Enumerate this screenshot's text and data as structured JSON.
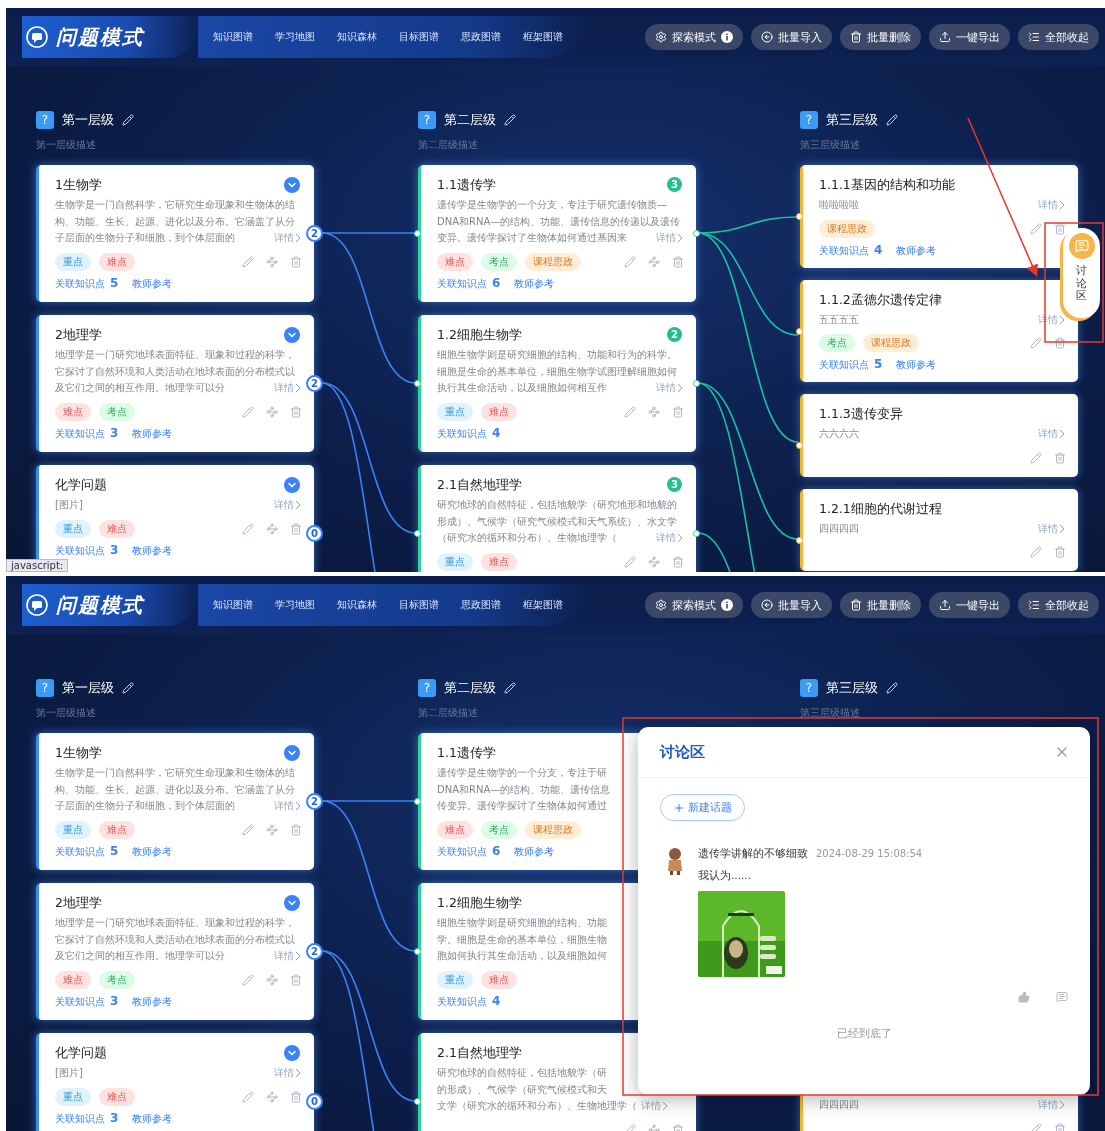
{
  "screens": [
    {
      "header": {
        "title": "问题模式",
        "nav": [
          "知识图谱",
          "学习地图",
          "知识森林",
          "目标图谱",
          "思政图谱",
          "框架图谱"
        ],
        "actions": [
          {
            "label": "探索模式",
            "kind": "explore"
          },
          {
            "label": "批量导入",
            "kind": "import"
          },
          {
            "label": "批量删除",
            "kind": "delete"
          },
          {
            "label": "一键导出",
            "kind": "export"
          },
          {
            "label": "全部收起",
            "kind": "collapse"
          }
        ]
      },
      "columns": [
        {
          "kind": "first",
          "mark": "?",
          "title": "第一层级",
          "description": "第一层级描述",
          "cards": [
            {
              "title": "1生物学",
              "description": "生物学是一门自然科学，它研究生命现象和生物体的结构、功能、生长、起源、进化以及分布。它涵盖了从分子层面的生物分子和细胞，到个体层面的",
              "detail": "详情",
              "tags": [
                {
                  "label": "重点",
                  "kind": "key"
                },
                {
                  "label": "难点",
                  "kind": "hard"
                }
              ],
              "related_label": "关联知识点",
              "related_count": "5",
              "reference": "教师参考",
              "links": "2",
              "tools": true
            },
            {
              "title": "2地理学",
              "description": "地理学是一门研究地球表面特征、现象和过程的科学，它探讨了自然环境和人类活动在地球表面的分布模式以及它们之间的相互作用。地理学可以分",
              "detail": "详情",
              "tags": [
                {
                  "label": "难点",
                  "kind": "hard"
                },
                {
                  "label": "考点",
                  "kind": "exam"
                }
              ],
              "related_label": "关联知识点",
              "related_count": "3",
              "reference": "教师参考",
              "links": "2",
              "tools": true
            },
            {
              "title": "化学问题",
              "description": "[图片]",
              "detail": "详情",
              "tags": [
                {
                  "label": "重点",
                  "kind": "key"
                },
                {
                  "label": "难点",
                  "kind": "hard"
                }
              ],
              "related_label": "关联知识点",
              "related_count": "3",
              "reference": "教师参考",
              "links": "0",
              "tools": true
            }
          ]
        },
        {
          "kind": "second",
          "mark": "?",
          "title": "第二层级",
          "description": "第二层级描述",
          "cards": [
            {
              "title": "1.1遗传学",
              "description": "遗传学是生物学的一个分支，专注于研究遗传物质—DNA和RNA—的结构、功能、遗传信息的传递以及遗传变异。遗传学探讨了生物体如何通过基因来",
              "detail": "详情",
              "tags": [
                {
                  "label": "难点",
                  "kind": "hard"
                },
                {
                  "label": "考点",
                  "kind": "exam"
                },
                {
                  "label": "课程思政",
                  "kind": "ideology"
                }
              ],
              "related_label": "关联知识点",
              "related_count": "6",
              "reference": "教师参考",
              "count": "3",
              "tools": true
            },
            {
              "title": "1.2细胞生物学",
              "description": "细胞生物学则是研究细胞的结构、功能和行为的科学。细胞是生命的基本单位，细胞生物学试图理解细胞如何执行其生命活动，以及细胞如何相互作",
              "detail": "详情",
              "tags": [
                {
                  "label": "重点",
                  "kind": "key"
                },
                {
                  "label": "难点",
                  "kind": "hard"
                }
              ],
              "related_label": "关联知识点",
              "related_count": "4",
              "count": "2",
              "tools": true
            },
            {
              "title": "2.1自然地理学",
              "description": "研究地球的自然特征，包括地貌学（研究地形和地貌的形成）、气候学（研究气候模式和天气系统）、水文学（研究水的循环和分布）、生物地理学（",
              "detail": "详情",
              "tags": [
                {
                  "label": "重点",
                  "kind": "key"
                },
                {
                  "label": "难点",
                  "kind": "hard"
                }
              ],
              "count": "3",
              "tools": true
            }
          ]
        },
        {
          "kind": "third",
          "mark": "?",
          "title": "第三层级",
          "description": "第三层级描述",
          "cards": [
            {
              "title": "1.1.1基因的结构和功能",
              "description": "啦啦啦啦",
              "detail": "详情",
              "tags": [
                {
                  "label": "课程思政",
                  "kind": "ideology"
                }
              ],
              "related_label": "关联知识点",
              "related_count": "4",
              "reference": "教师参考",
              "tools": true
            },
            {
              "title": "1.1.2孟德尔遗传定律",
              "description": "五五五五",
              "detail": "详情",
              "tags": [
                {
                  "label": "考点",
                  "kind": "exam"
                },
                {
                  "label": "课程思政",
                  "kind": "ideology"
                }
              ],
              "related_label": "关联知识点",
              "related_count": "5",
              "reference": "教师参考",
              "tools": true
            },
            {
              "title": "1.1.3遗传变异",
              "description": "六六六六",
              "detail": "详情",
              "tools": true
            },
            {
              "title": "1.2.1细胞的代谢过程",
              "description": "四四四四",
              "detail": "详情",
              "tools": true
            }
          ]
        }
      ],
      "discussion_tab": {
        "label": "讨论区"
      },
      "status_text": "javascript:",
      "annotation": {
        "kind": "tab-callout"
      }
    },
    {
      "header": {
        "title": "问题模式",
        "nav": [
          "知识图谱",
          "学习地图",
          "知识森林",
          "目标图谱",
          "思政图谱",
          "框架图谱"
        ],
        "actions": [
          {
            "label": "探索模式",
            "kind": "explore"
          },
          {
            "label": "批量导入",
            "kind": "import"
          },
          {
            "label": "批量删除",
            "kind": "delete"
          },
          {
            "label": "一键导出",
            "kind": "export"
          },
          {
            "label": "全部收起",
            "kind": "collapse"
          }
        ]
      },
      "columns": [
        {
          "kind": "first",
          "mark": "?",
          "title": "第一层级",
          "description": "第一层级描述",
          "cards": [
            {
              "title": "1生物学",
              "description": "生物学是一门自然科学，它研究生命现象和生物体的结构、功能、生长、起源、进化以及分布。它涵盖了从分子层面的生物分子和细胞，到个体层面的",
              "detail": "详情",
              "tags": [
                {
                  "label": "重点",
                  "kind": "key"
                },
                {
                  "label": "难点",
                  "kind": "hard"
                }
              ],
              "related_label": "关联知识点",
              "related_count": "5",
              "reference": "教师参考",
              "links": "2",
              "tools": true
            },
            {
              "title": "2地理学",
              "description": "地理学是一门研究地球表面特征、现象和过程的科学，它探讨了自然环境和人类活动在地球表面的分布模式以及它们之间的相互作用。地理学可以分",
              "detail": "详情",
              "tags": [
                {
                  "label": "难点",
                  "kind": "hard"
                },
                {
                  "label": "考点",
                  "kind": "exam"
                }
              ],
              "related_label": "关联知识点",
              "related_count": "3",
              "reference": "教师参考",
              "links": "2",
              "tools": true
            },
            {
              "title": "化学问题",
              "description": "[图片]",
              "detail": "详情",
              "tags": [
                {
                  "label": "重点",
                  "kind": "key"
                },
                {
                  "label": "难点",
                  "kind": "hard"
                }
              ],
              "related_label": "关联知识点",
              "related_count": "3",
              "reference": "教师参考",
              "links": "0",
              "tools": true
            }
          ]
        },
        {
          "kind": "second",
          "mark": "?",
          "title": "第二层级",
          "description": "第二层级描述",
          "cards": [
            {
              "title": "1.1遗传学",
              "lines": [
                "遗传学是生物学的一个分支，专注于研",
                "DNA和RNA—的结构、功能、遗传信息",
                "传变异。遗传学探讨了生物体如何通过"
              ],
              "tags": [
                {
                  "label": "难点",
                  "kind": "hard"
                },
                {
                  "label": "考点",
                  "kind": "exam"
                },
                {
                  "label": "课程思政",
                  "kind": "ideology"
                }
              ],
              "related_label": "关联知识点",
              "related_count": "6",
              "reference": "教师参考",
              "tools": false
            },
            {
              "title": "1.2细胞生物学",
              "lines": [
                "细胞生物学则是研究细胞的结构、功能",
                "学。细胞是生命的基本单位，细胞生物",
                "胞如何执行其生命活动，以及细胞如何"
              ],
              "tags": [
                {
                  "label": "重点",
                  "kind": "key"
                },
                {
                  "label": "难点",
                  "kind": "hard"
                }
              ],
              "related_label": "关联知识点",
              "related_count": "4",
              "tools": false
            },
            {
              "title": "2.1自然地理学",
              "lines": [
                "研究地球的自然特征，包括地貌学（研",
                "的形成）、气候学（研究气候模式和天",
                "文学（研究水的循环和分布）、生物地理学（"
              ],
              "detail": "详情",
              "tools": true
            }
          ]
        },
        {
          "kind": "third",
          "mark": "?",
          "title": "第三层级",
          "description": "第三层级描述",
          "cards": [
            {
              "description": "四四四四",
              "detail": "详情",
              "tools": true
            }
          ]
        }
      ],
      "dialog": {
        "title": "讨论区",
        "new_topic": "新建话题",
        "posts": [
          {
            "title": "遗传学讲解的不够细致",
            "time": "2024-08-29 15:08:54",
            "body": "我认为......"
          }
        ],
        "end_text": "已经到底了"
      },
      "annotation": {
        "kind": "dialog-frame"
      }
    }
  ]
}
